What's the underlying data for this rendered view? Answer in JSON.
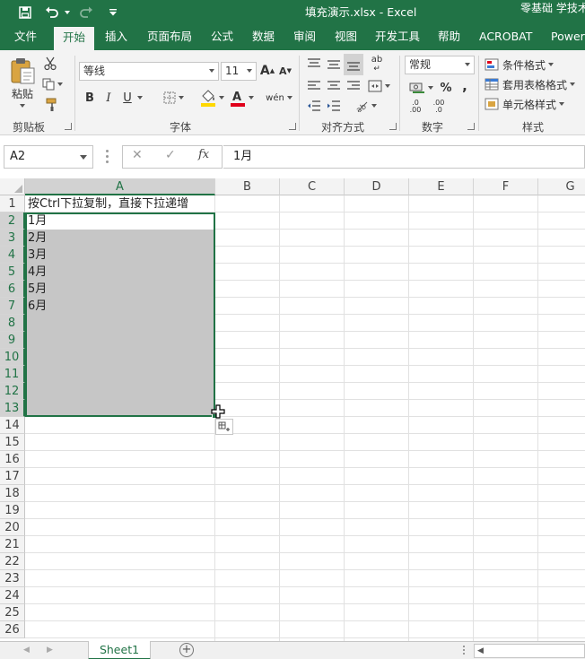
{
  "titlebar": {
    "title": "填充演示.xlsx  -  Excel",
    "user": "零基础 学技术",
    "icons": [
      "save-icon",
      "undo-icon",
      "redo-icon",
      "customize-quick-access-icon"
    ]
  },
  "tabs": [
    "文件",
    "开始",
    "插入",
    "页面布局",
    "公式",
    "数据",
    "审阅",
    "视图",
    "开发工具",
    "帮助",
    "ACROBAT",
    "Power"
  ],
  "active_tab": "开始",
  "ribbon": {
    "clipboard": {
      "label": "剪贴板",
      "paste": "粘贴"
    },
    "font": {
      "label": "字体",
      "font_name": "等线",
      "font_size": "11",
      "bold": "B",
      "italic": "I",
      "underline": "U",
      "grow": "A",
      "shrink": "A",
      "phonetic": "wén"
    },
    "alignment": {
      "label": "对齐方式",
      "wrap": "ab"
    },
    "number": {
      "label": "数字",
      "format": "常规",
      "percent": "%",
      "comma": ",",
      "inc_decimal": ".0 .00",
      "dec_decimal": ".00 .0"
    },
    "styles": {
      "label": "样式",
      "conditional": "条件格式",
      "table": "套用表格格式",
      "cell": "单元格样式"
    }
  },
  "formula_bar": {
    "name_box": "A2",
    "cancel": "✕",
    "enter": "✓",
    "fx": "fx",
    "formula": "1月"
  },
  "columns": [
    "A",
    "B",
    "C",
    "D",
    "E",
    "F",
    "G"
  ],
  "selected_column": "A",
  "rows": [
    "1",
    "2",
    "3",
    "4",
    "5",
    "6",
    "7",
    "8",
    "9",
    "10",
    "11",
    "12",
    "13",
    "14",
    "15",
    "16",
    "17",
    "18",
    "19",
    "20",
    "21",
    "22",
    "23",
    "24",
    "25",
    "26"
  ],
  "cells_a": [
    "按Ctrl下拉复制，直接下拉递增",
    "1月",
    "2月",
    "3月",
    "4月",
    "5月",
    "6月"
  ],
  "sheet": {
    "name": "Sheet1",
    "add": "+"
  },
  "colors": {
    "accent": "#217346",
    "selection": "#c6c6c6",
    "ribbon_bg": "#f3f3f3"
  }
}
